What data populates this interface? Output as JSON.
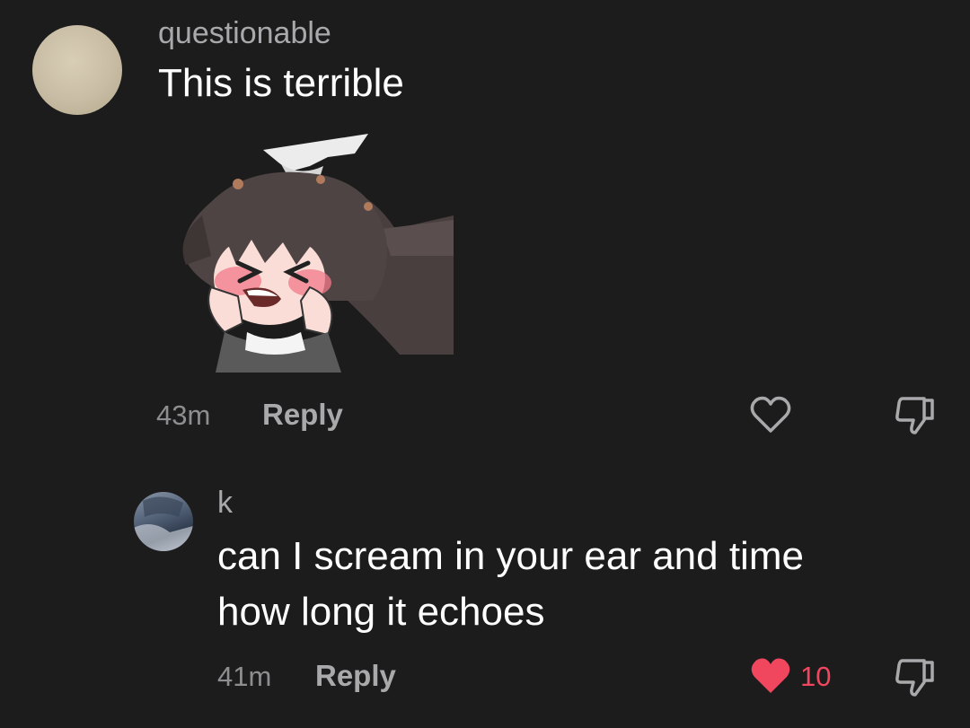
{
  "comments": [
    {
      "username": "questionable",
      "text": "This is terrible",
      "time": "43m",
      "reply_label": "Reply",
      "liked": false
    },
    {
      "username": "k",
      "text_line1": "can I scream in your ear and time",
      "text_line2": "how long it echoes",
      "time": "41m",
      "reply_label": "Reply",
      "liked": true,
      "like_count": "10"
    }
  ],
  "colors": {
    "background": "#1c1c1d",
    "like_active": "#f0465e",
    "muted_text": "#a9a9ab"
  },
  "icons": {
    "like": "heart-outline-icon",
    "like_active": "heart-filled-icon",
    "dislike": "thumbs-down-icon"
  }
}
